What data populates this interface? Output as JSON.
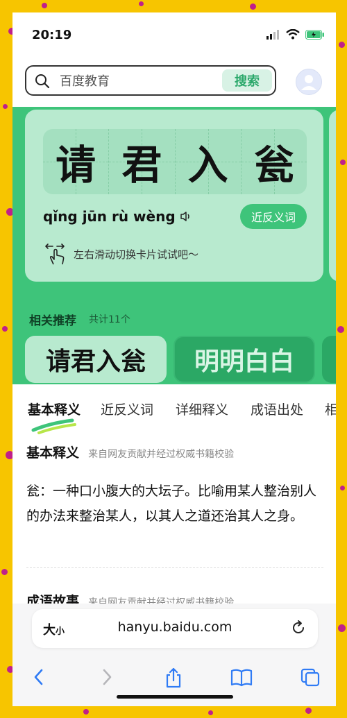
{
  "status_bar": {
    "time": "20:19"
  },
  "search": {
    "placeholder": "百度教育",
    "button_label": "搜索"
  },
  "idiom_card": {
    "characters": [
      "请",
      "君",
      "入",
      "瓮"
    ],
    "pinyin": "qǐng jūn rù wèng",
    "antonym_button": "近反义词",
    "swipe_hint": "左右滑动切换卡片试试吧～"
  },
  "related": {
    "title": "相关推荐",
    "count": "共计11个",
    "items": [
      "请君入瓮",
      "明明白白"
    ]
  },
  "tabs": [
    "基本释义",
    "近反义词",
    "详细释义",
    "成语出处",
    "相"
  ],
  "basic": {
    "title": "基本释义",
    "source": "来自网友贡献并经过权威书籍校验",
    "definition": "瓮：一种口小腹大的大坛子。比喻用某人整治别人的办法来整治某人，以其人之道还治其人之身。"
  },
  "story": {
    "title": "成语故事",
    "source": "来自网友贡献并经过权威书籍校验"
  },
  "browser": {
    "text_size_big": "大",
    "text_size_small": "小",
    "url": "hanyu.baidu.com"
  },
  "colors": {
    "primary_green": "#3ec47a",
    "card_green": "#b8eacf",
    "background_yellow": "#f7c500",
    "dot_magenta": "#c0208a"
  }
}
